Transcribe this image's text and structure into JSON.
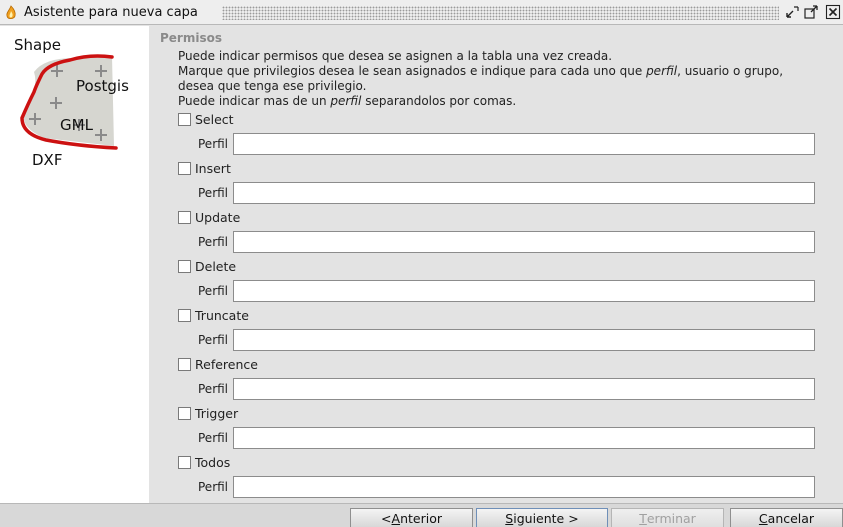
{
  "window": {
    "title": "Asistente para nueva capa",
    "icon": "app-flame-icon",
    "controls": [
      "minimize-icon",
      "maximize-icon",
      "close-icon"
    ]
  },
  "sidebar": {
    "formats": [
      "Shape",
      "Postgis",
      "GML",
      "DXF"
    ],
    "accent_color": "#cc1111"
  },
  "permissions": {
    "title": "Permisos",
    "desc_line1": "Puede indicar permisos que desea se asignen a la tabla una vez creada.",
    "desc_line2_a": "Marque que privilegios desea le sean asignados e indique para cada uno que ",
    "desc_line2_em": "perfil",
    "desc_line2_b": ", usuario o grupo,",
    "desc_line3": "desea que tenga ese privilegio.",
    "desc_line4_a": "Puede indicar mas de un ",
    "desc_line4_em": "perfil",
    "desc_line4_b": " separandolos por comas.",
    "perfil_label": "Perfil",
    "items": [
      {
        "label": "Select",
        "checked": false,
        "perfil": ""
      },
      {
        "label": "Insert",
        "checked": false,
        "perfil": ""
      },
      {
        "label": "Update",
        "checked": false,
        "perfil": ""
      },
      {
        "label": "Delete",
        "checked": false,
        "perfil": ""
      },
      {
        "label": "Truncate",
        "checked": false,
        "perfil": ""
      },
      {
        "label": "Reference",
        "checked": false,
        "perfil": ""
      },
      {
        "label": "Trigger",
        "checked": false,
        "perfil": ""
      },
      {
        "label": "Todos",
        "checked": false,
        "perfil": ""
      }
    ]
  },
  "buttons": {
    "back": {
      "pre": "< ",
      "mn": "A",
      "post": "nterior"
    },
    "next": {
      "pre": "",
      "mn": "S",
      "post": "iguiente >"
    },
    "finish": {
      "pre": "",
      "mn": "T",
      "post": "erminar"
    },
    "cancel": {
      "pre": "",
      "mn": "C",
      "post": "ancelar"
    }
  }
}
